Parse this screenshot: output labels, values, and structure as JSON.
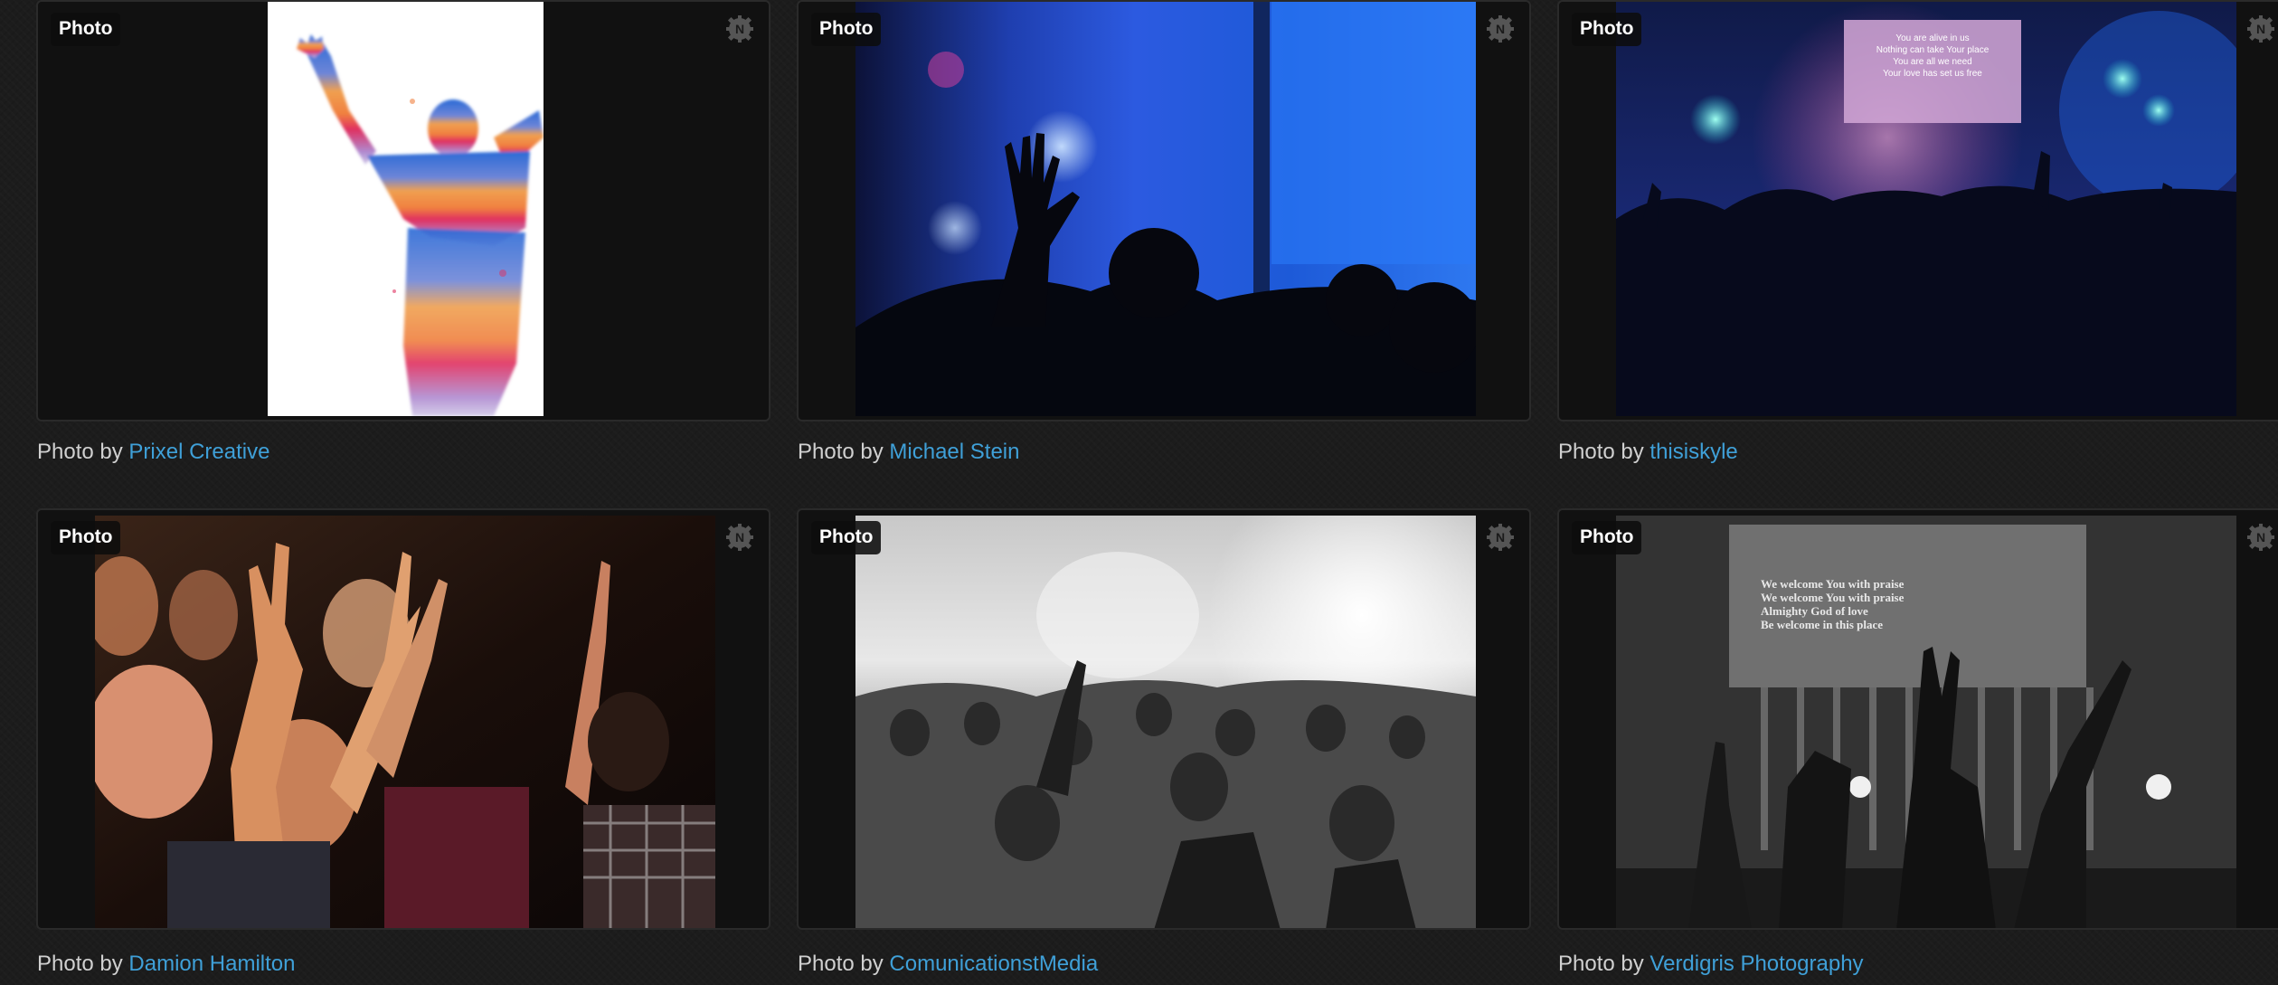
{
  "badge_label": "Photo",
  "caption_prefix": "Photo by",
  "icon_names": {
    "type_badge": "photo-type-badge",
    "corner_logo": "n-gear-logo-icon"
  },
  "colors": {
    "background": "#1c1c1c",
    "card": "#111111",
    "link": "#3fa0d8",
    "caption_text": "#d0d0d0"
  },
  "photos": [
    {
      "author": "Prixel Creative",
      "image": "watercolor silhouette of person with raised arms, blue to orange to red"
    },
    {
      "author": "Michael Stein",
      "image": "raised hand silhouette against blue stage lights"
    },
    {
      "author": "thisiskyle",
      "image": "concert crowd with raised hands, pink and blue stage lights, lyric screen"
    },
    {
      "author": "Damion Hamilton",
      "image": "crowd worshipping with raised hands, warm tones"
    },
    {
      "author": "ComunicationstMedia",
      "image": "black and white crowd facing a bright stage"
    },
    {
      "author": "Verdigris Photography",
      "image": "black and white worship service with lyric screen and raised hands"
    }
  ],
  "lyrics": {
    "card3": [
      "You are alive in us",
      "Nothing can take Your place",
      "You are all we need",
      "Your love has set us free"
    ],
    "card6": [
      "We welcome You with praise",
      "We welcome You with praise",
      "Almighty God of love",
      "Be welcome in this place"
    ]
  }
}
